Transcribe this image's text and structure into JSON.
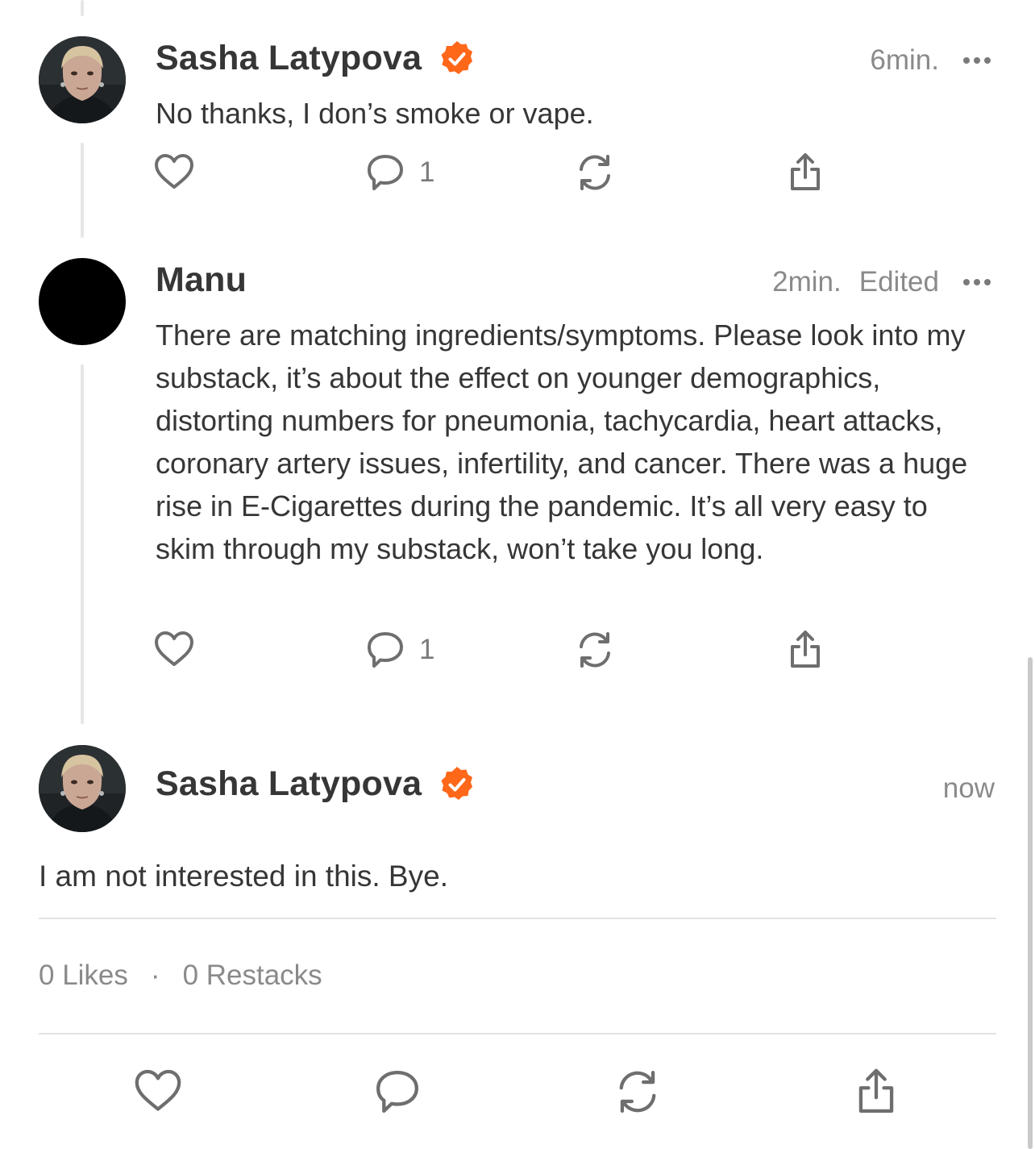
{
  "comments": [
    {
      "author": "Sasha Latypova",
      "verified": true,
      "time": "6min.",
      "edited": "",
      "text": "No thanks, I don’s smoke or vape.",
      "reply_count": "1"
    },
    {
      "author": "Manu",
      "verified": false,
      "time": "2min.",
      "edited": "Edited",
      "text": "There are matching ingredients/symptoms. Please look into my substack, it’s about the effect on younger demographics, distorting numbers for pneumonia, tachycardia, heart attacks, coronary artery issues, infertility, and cancer. There was a huge rise in E-Cigarettes during the pandemic. It’s all very easy to skim through my substack, won’t take you long.",
      "reply_count": "1"
    }
  ],
  "focused": {
    "author": "Sasha Latypova",
    "verified": true,
    "time": "now",
    "text": "I am not interested in this. Bye."
  },
  "stats": {
    "likes": "0 Likes",
    "separator": "·",
    "restacks": "0 Restacks"
  },
  "colors": {
    "verified_badge": "#FF6719",
    "text": "#363636",
    "muted": "#8A8A8A",
    "icon": "#6E6E6E",
    "divider": "#E3E3E3"
  },
  "icons": {
    "like": "heart-icon",
    "comment": "comment-bubble-icon",
    "restack": "restack-icon",
    "share": "share-icon",
    "more": "more-dots-icon",
    "verified": "verified-badge-icon"
  }
}
